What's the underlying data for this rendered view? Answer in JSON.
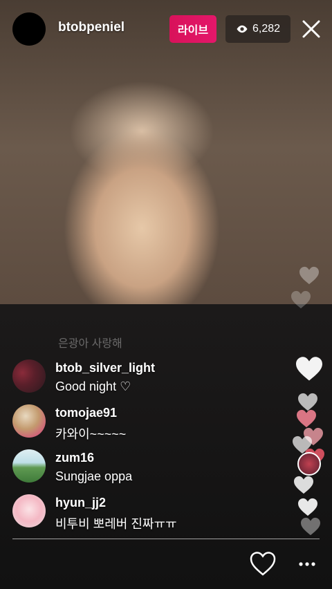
{
  "header": {
    "username": "btobpeniel",
    "live_label": "라이브",
    "viewer_count": "6,282"
  },
  "faded_comment": "은광아 사랑해",
  "comments": [
    {
      "user": "btob_silver_light",
      "text": "Good  night ♡"
    },
    {
      "user": "tomojae91",
      "text": "카와이~~~~~"
    },
    {
      "user": "zum16",
      "text": "Sungjae oppa"
    },
    {
      "user": "hyun_jj2",
      "text": "비투비 뽀레버 진짜ㅠㅠ"
    }
  ],
  "icons": [
    "eye-icon",
    "close-icon",
    "heart-icon",
    "more-icon"
  ],
  "colors": {
    "live_badge": "#e4176a",
    "text": "#ffffff"
  }
}
